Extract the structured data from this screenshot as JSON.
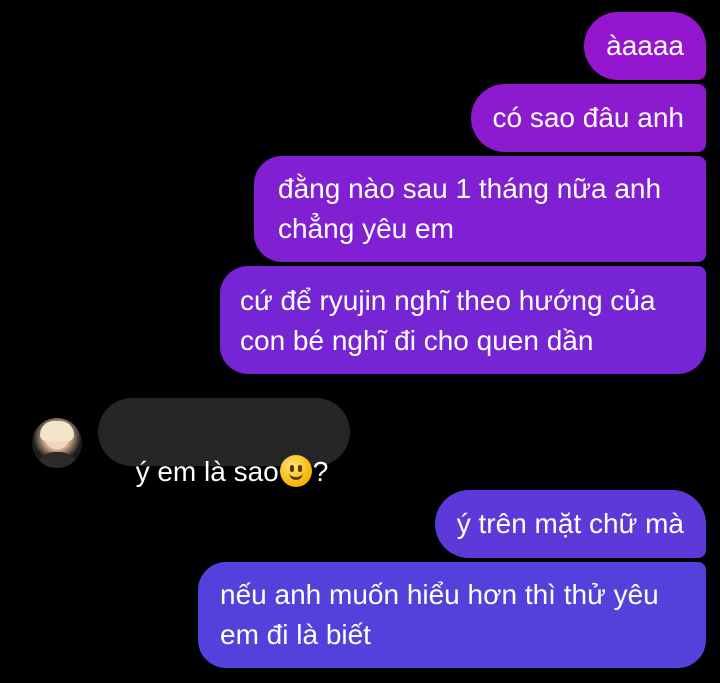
{
  "messages": {
    "m1": "àaaaa",
    "m2": "có sao đâu anh",
    "m3": "đằng nào sau 1 tháng nữa anh\nchẳng yêu em",
    "m4": "cứ để ryujin nghĩ theo hướng của\ncon bé nghĩ đi cho quen dần",
    "incoming_before_emoji": "ý em là sao",
    "incoming_after_emoji": "?",
    "m5": "ý trên mặt chữ mà",
    "m6": "nếu anh muốn hiểu hơn thì thử yêu\nem đi là biết"
  },
  "icons": {
    "emoji": "grinning-face-emoji",
    "avatar": "contact-avatar"
  },
  "colors": {
    "background": "#000000",
    "incoming_bubble": "#262626",
    "outgoing_gradient_top": "#9417cf",
    "outgoing_gradient_bottom": "#5440db"
  }
}
